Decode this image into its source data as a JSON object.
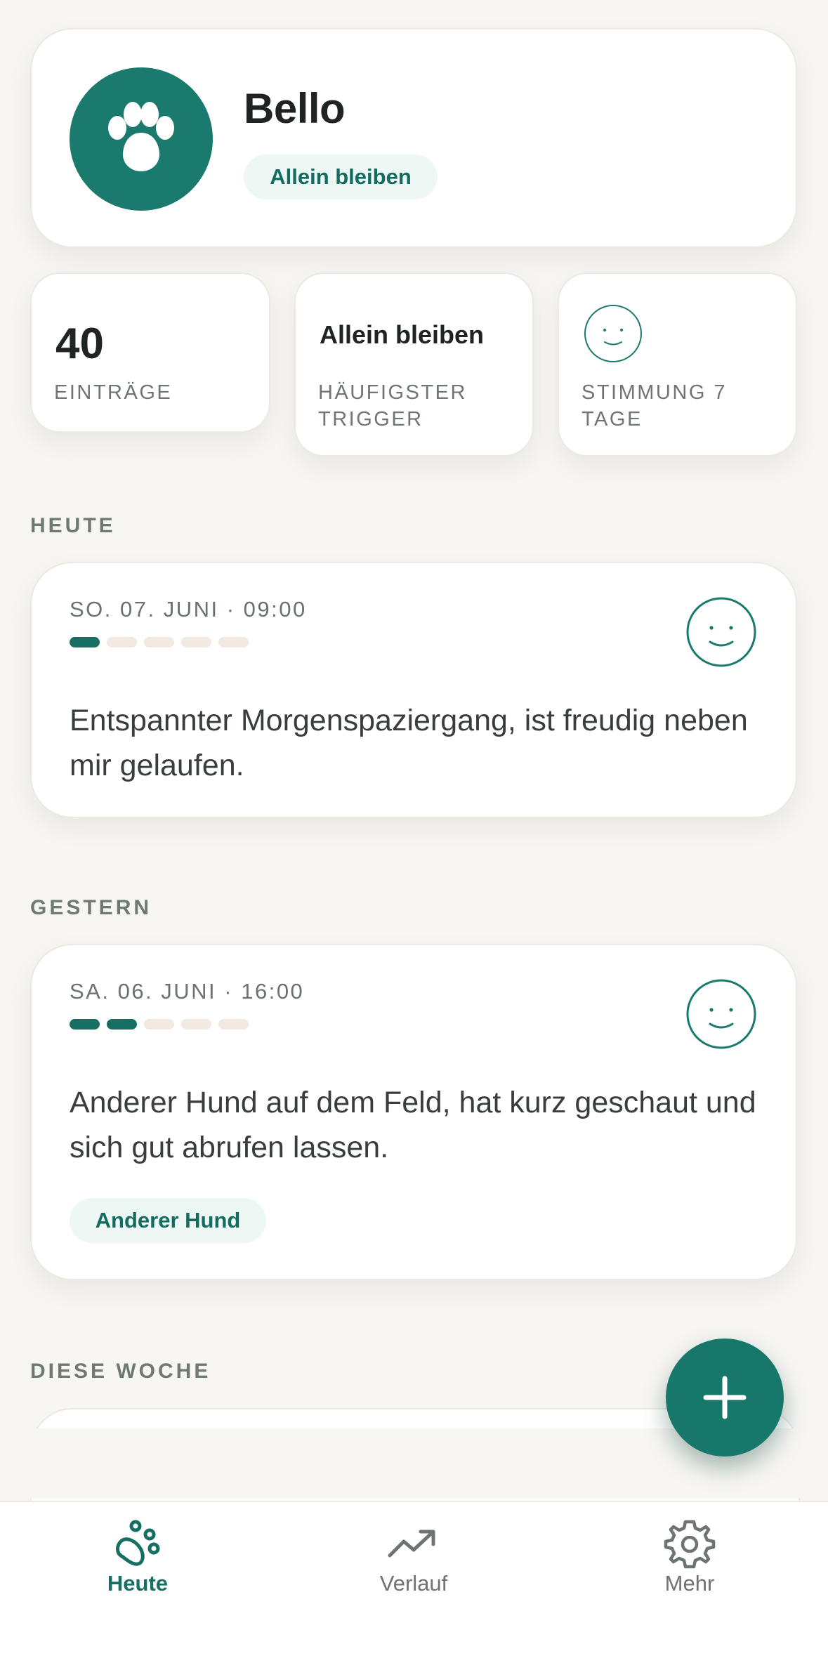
{
  "profile": {
    "name": "Bello",
    "trigger_chip": "Allein bleiben",
    "avatar_icon": "paw-icon"
  },
  "stats": {
    "entries": {
      "value": "40",
      "label": "EINTRÄGE"
    },
    "trigger": {
      "value": "Allein bleiben",
      "label": "HÄUFIGSTER TRIGGER"
    },
    "mood": {
      "icon": "smiley-icon",
      "label": "STIMMUNG 7 TAGE"
    }
  },
  "sections": {
    "today": "HEUTE",
    "yesterday": "GESTERN",
    "this_week": "DIESE WOCHE"
  },
  "entries": [
    {
      "date": "SO. 07. JUNI · 09:00",
      "intensity": 1,
      "intensity_max": 5,
      "mood_icon": "smiley-icon",
      "text": "Entspannter Morgenspaziergang, ist freudig neben mir gelaufen."
    },
    {
      "date": "SA. 06. JUNI · 16:00",
      "intensity": 2,
      "intensity_max": 5,
      "mood_icon": "smiley-icon",
      "text": "Anderer Hund auf dem Feld, hat kurz geschaut und sich gut abrufen lassen.",
      "tag": "Anderer Hund"
    }
  ],
  "fab": {
    "icon": "plus-icon"
  },
  "tabs": [
    {
      "label": "Heute",
      "icon": "paw-outline-icon",
      "active": true
    },
    {
      "label": "Verlauf",
      "icon": "trend-up-icon",
      "active": false
    },
    {
      "label": "Mehr",
      "icon": "gear-icon",
      "active": false
    }
  ],
  "colors": {
    "accent": "#1A7A6E",
    "background": "#F7F6F3",
    "chip_bg": "#EDF8F5",
    "dot_inactive": "#F0EAE0"
  }
}
